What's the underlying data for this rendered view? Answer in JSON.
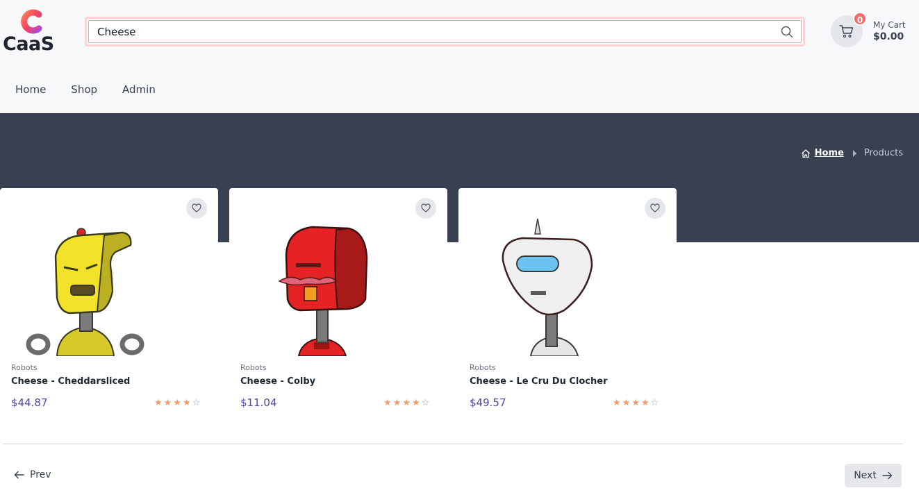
{
  "brand": {
    "name": "CaaS",
    "logo_letter": "C"
  },
  "search": {
    "value": "Cheese",
    "icon": "search-icon"
  },
  "cart": {
    "count": "0",
    "label": "My Cart",
    "total": "$0.00",
    "icon": "cart-icon"
  },
  "nav": {
    "items": [
      {
        "label": "Home"
      },
      {
        "label": "Shop"
      },
      {
        "label": "Admin"
      }
    ]
  },
  "breadcrumb": {
    "home": "Home",
    "current": "Products"
  },
  "products": [
    {
      "category": "Robots",
      "name": "Cheese - Cheddarsliced",
      "price": "$44.87",
      "rating": 4,
      "rating_max": 5,
      "robot_color": "#f2e22a"
    },
    {
      "category": "Robots",
      "name": "Cheese - Colby",
      "price": "$11.04",
      "rating": 4,
      "rating_max": 5,
      "robot_color": "#e52324"
    },
    {
      "category": "Robots",
      "name": "Cheese - Le Cru Du Clocher",
      "price": "$49.57",
      "rating": 4,
      "rating_max": 5,
      "robot_color": "#e8e8e8"
    }
  ],
  "pagination": {
    "prev": "Prev",
    "next": "Next"
  },
  "colors": {
    "hero_bg": "#394051",
    "price": "#4f46a5",
    "star": "#f39b6b",
    "badge": "#f26b6b"
  }
}
